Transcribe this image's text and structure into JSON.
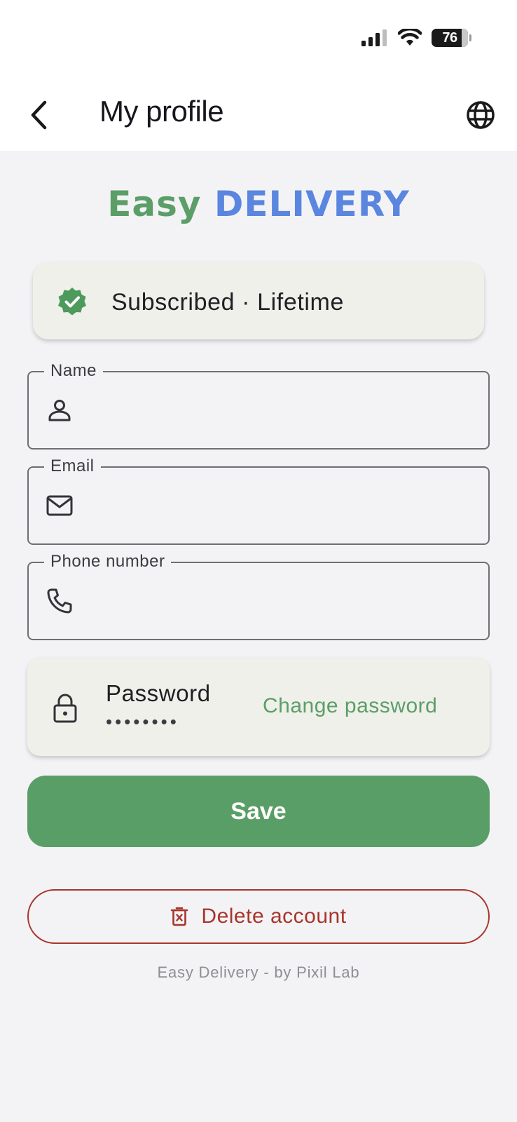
{
  "status_bar": {
    "battery": "76"
  },
  "app_bar": {
    "title": "My profile"
  },
  "logo": {
    "easy": "Easy",
    "delivery": "DELIVERY"
  },
  "subscription": {
    "text": "Subscribed · Lifetime"
  },
  "form": {
    "name": {
      "label": "Name",
      "value": ""
    },
    "email": {
      "label": "Email",
      "value": ""
    },
    "phone": {
      "label": "Phone number",
      "value": ""
    }
  },
  "password": {
    "label": "Password",
    "masked": "••••••••",
    "change_label": "Change password"
  },
  "actions": {
    "save_label": "Save",
    "delete_label": "Delete account"
  },
  "footer": {
    "text": "Easy Delivery - by Pixil Lab"
  },
  "colors": {
    "brand_green": "#5a9e67",
    "brand_blue": "#5b86e0",
    "danger": "#a8352b",
    "background": "#f3f3f6"
  }
}
